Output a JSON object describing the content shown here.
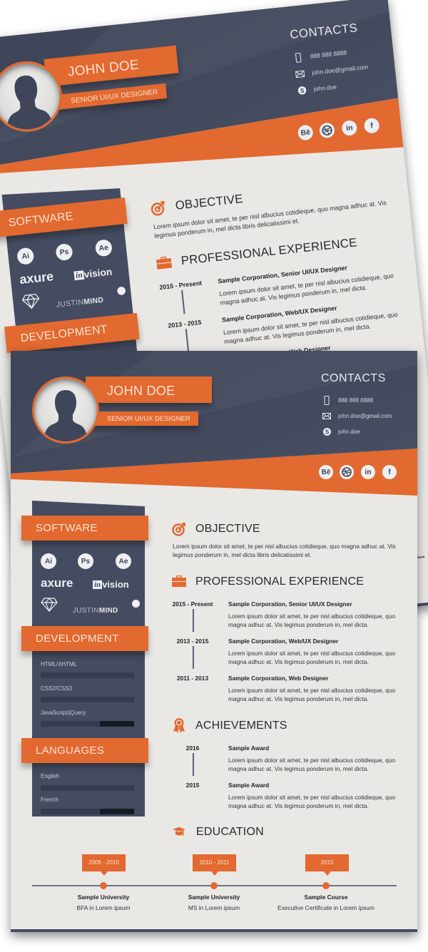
{
  "header": {
    "name": "JOHN DOE",
    "title": "SENIOR UI/UX DESIGNER",
    "contacts_heading": "CONTACTS",
    "contacts": [
      {
        "icon": "phone-icon",
        "text": "888 888 8888"
      },
      {
        "icon": "mail-icon",
        "text": "john.doe@gmail.com"
      },
      {
        "icon": "skype-icon",
        "text": "john.doe"
      }
    ],
    "social": [
      {
        "icon": "behance-icon",
        "glyph": "Bē"
      },
      {
        "icon": "dribbble-icon",
        "glyph": ""
      },
      {
        "icon": "linkedin-icon",
        "glyph": "in"
      },
      {
        "icon": "facebook-icon",
        "glyph": "f"
      }
    ]
  },
  "sidebar": {
    "software_heading": "SOFTWARE",
    "software": [
      "Ai",
      "Ps",
      "Ae",
      "axure",
      "in",
      "vision",
      "JUSTIN",
      "MIND"
    ],
    "development_heading": "DEVELOPMENT",
    "development": [
      {
        "label": "HTML/XHTML",
        "level": 1.0
      },
      {
        "label": "CSS2/CSS3",
        "level": 1.0
      },
      {
        "label": "JavaScript/jQuery",
        "level": 0.63
      }
    ],
    "languages_heading": "LANGUAGES",
    "languages": [
      {
        "label": "English",
        "level": 1.0
      },
      {
        "label": "French",
        "level": 0.63
      }
    ]
  },
  "main": {
    "objective": {
      "heading": "OBJECTIVE",
      "text": "Lorem ipsum dolor sit amet, te per nisl albucius cotidieque, quo magna adhuc at. Vis legimus ponderum in, mel dicta libris delicatissimi et."
    },
    "experience": {
      "heading": "PROFESSIONAL EXPERIENCE",
      "items": [
        {
          "date": "2015 - Present",
          "title": "Sample Corporation, Senior UI/UX Designer",
          "text": "Lorem ipsum dolor sit amet, te per nisl albucius cotidieque, quo magna adhuc at. Vis legimus ponderum in, mel dicta."
        },
        {
          "date": "2013 - 2015",
          "title": "Sample Corporation, Web/UX Designer",
          "text": "Lorem ipsum dolor sit amet, te per nisl albucius cotidieque, quo magna adhuc at. Vis legimus ponderum in, mel dicta."
        },
        {
          "date": "2011 - 2013",
          "title": "Sample Corporation, Web Designer",
          "text": "Lorem ipsum dolor sit amet, te per nisl albucius cotidieque, quo magna adhuc at. Vis legimus ponderum in, mel dicta."
        }
      ]
    },
    "achievements": {
      "heading": "ACHIEVEMENTS",
      "items": [
        {
          "date": "2016",
          "title": "Sample Award",
          "text": "Lorem ipsum dolor sit amet, te per nisl albucius cotidieque, quo magna adhuc at. Vis legimus ponderum in, mel dicta."
        },
        {
          "date": "2015",
          "title": "Sample Award",
          "text": "Lorem ipsum dolor sit amet, te per nisl albucius cotidieque, quo magna adhuc at. Vis legimus ponderum in, mel dicta."
        }
      ]
    },
    "education": {
      "heading": "EDUCATION",
      "items": [
        {
          "date": "2006 - 2010",
          "name": "Sample University",
          "degree": "BFA in Lorem ipsum"
        },
        {
          "date": "2010 - 2011",
          "name": "Sample University",
          "degree": "MS in Lorem ipsum"
        },
        {
          "date": "2015",
          "name": "Sample Course",
          "degree": "Executive Certificate in Lorem ipsum"
        }
      ]
    }
  },
  "colors": {
    "accent": "#e2692f",
    "navy": "#434a5e",
    "paper": "#e9e8e5"
  }
}
